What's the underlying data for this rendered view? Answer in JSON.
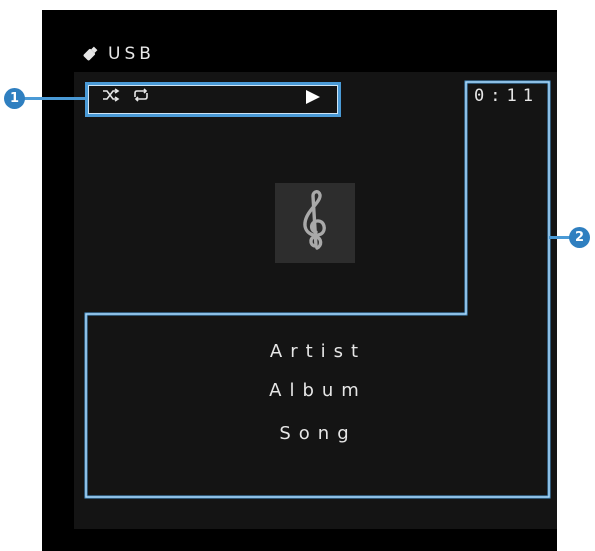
{
  "header": {
    "source": "USB",
    "source_icon": "usb-stick-icon"
  },
  "status": {
    "shuffle_icon": "shuffle-icon",
    "repeat_icon": "repeat-icon",
    "playback_icon": "play-icon",
    "elapsed_time": "0:11"
  },
  "artwork": {
    "icon": "treble-clef-icon",
    "glyph": "𝄞"
  },
  "track": {
    "artist": "Artist",
    "album": "Album",
    "song": "Song"
  },
  "callouts": [
    {
      "number": "1"
    },
    {
      "number": "2"
    }
  ],
  "colors": {
    "screen": "#000000",
    "callout": "#4a9ad6",
    "marker": "#2f7fc0"
  }
}
